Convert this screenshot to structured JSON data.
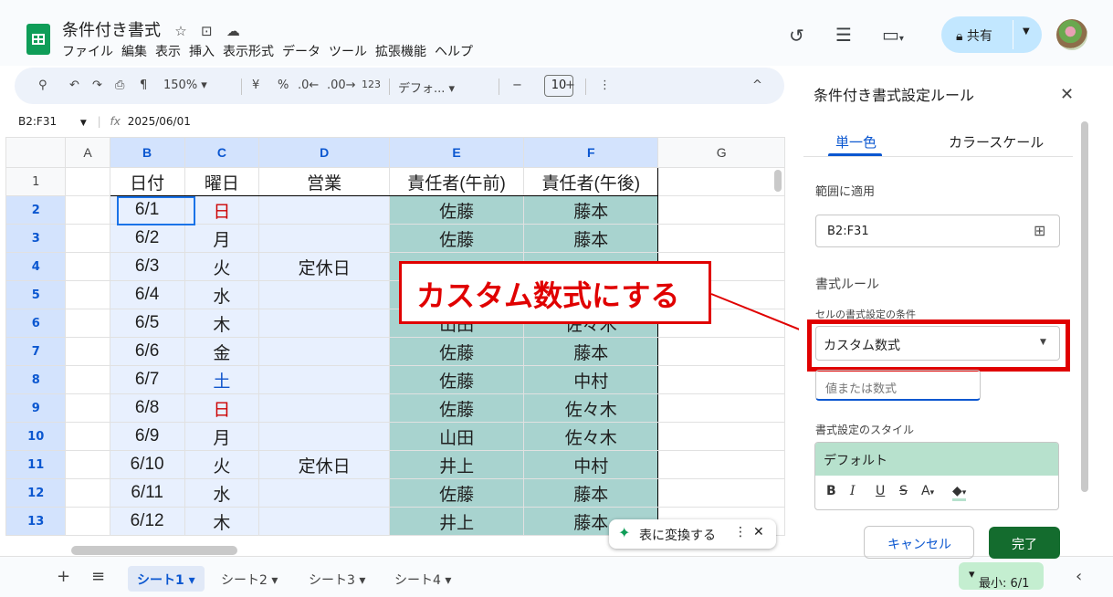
{
  "doc": {
    "title": "条件付き書式",
    "star_icon": "star-icon",
    "move_icon": "folder-move-icon",
    "cloud_icon": "cloud-icon",
    "menu": [
      "ファイル",
      "編集",
      "表示",
      "挿入",
      "表示形式",
      "データ",
      "ツール",
      "拡張機能",
      "ヘルプ"
    ]
  },
  "header": {
    "history_icon": "history-icon",
    "comment_icon": "comment-icon",
    "meet_icon": "video-icon",
    "share_label": "共有",
    "share_lock_icon": "lock-icon"
  },
  "toolbar": {
    "zoom": "150%",
    "currency": "¥",
    "percent": "%",
    "dec_minus": ".0←",
    "dec_plus": ".00→",
    "format123": "123",
    "font": "デフォ...",
    "font_size": "10",
    "minus": "−",
    "plus": "+",
    "more": "⋮",
    "collapse": "^"
  },
  "formula": {
    "name_box": "B2:F31",
    "fx": "fx",
    "value": "2025/06/01"
  },
  "columns": [
    "A",
    "B",
    "C",
    "D",
    "E",
    "F",
    "G"
  ],
  "rows": [
    {
      "n": "1",
      "b": "日付",
      "c": "曜日",
      "d": "営業",
      "e": "責任者(午前)",
      "f": "責任者(午後)",
      "ccolor": ""
    },
    {
      "n": "2",
      "b": "6/1",
      "c": "日",
      "d": "",
      "e": "佐藤",
      "f": "藤本",
      "ccolor": "red"
    },
    {
      "n": "3",
      "b": "6/2",
      "c": "月",
      "d": "",
      "e": "佐藤",
      "f": "藤本",
      "ccolor": ""
    },
    {
      "n": "4",
      "b": "6/3",
      "c": "火",
      "d": "定休日",
      "e": "",
      "f": "",
      "ccolor": ""
    },
    {
      "n": "5",
      "b": "6/4",
      "c": "水",
      "d": "",
      "e": "",
      "f": "",
      "ccolor": ""
    },
    {
      "n": "6",
      "b": "6/5",
      "c": "木",
      "d": "",
      "e": "山田",
      "f": "佐々木",
      "ccolor": ""
    },
    {
      "n": "7",
      "b": "6/6",
      "c": "金",
      "d": "",
      "e": "佐藤",
      "f": "藤本",
      "ccolor": ""
    },
    {
      "n": "8",
      "b": "6/7",
      "c": "土",
      "d": "",
      "e": "佐藤",
      "f": "中村",
      "ccolor": "blue"
    },
    {
      "n": "9",
      "b": "6/8",
      "c": "日",
      "d": "",
      "e": "佐藤",
      "f": "佐々木",
      "ccolor": "red"
    },
    {
      "n": "10",
      "b": "6/9",
      "c": "月",
      "d": "",
      "e": "山田",
      "f": "佐々木",
      "ccolor": ""
    },
    {
      "n": "11",
      "b": "6/10",
      "c": "火",
      "d": "定休日",
      "e": "井上",
      "f": "中村",
      "ccolor": ""
    },
    {
      "n": "12",
      "b": "6/11",
      "c": "水",
      "d": "",
      "e": "佐藤",
      "f": "藤本",
      "ccolor": ""
    },
    {
      "n": "13",
      "b": "6/12",
      "c": "木",
      "d": "",
      "e": "井上",
      "f": "藤本",
      "ccolor": ""
    }
  ],
  "callout": {
    "text": "カスタム数式にする"
  },
  "chip": {
    "label": "表に変換する",
    "star_icon": "sparkle-icon",
    "more": "⋮",
    "close": "✕"
  },
  "sheets": {
    "add": "+",
    "all": "≡",
    "tabs": [
      "シート1",
      "シート2",
      "シート3",
      "シート4"
    ],
    "summary": "最小: 6/1",
    "nav": "‹"
  },
  "panel": {
    "title": "条件付き書式設定ルール",
    "close": "✕",
    "tab_single": "単一色",
    "tab_scale": "カラースケール",
    "range_label": "範囲に適用",
    "range_value": "B2:F31",
    "rule_label": "書式ルール",
    "condition_label": "セルの書式設定の条件",
    "condition_value": "カスタム数式",
    "value_placeholder": "値または数式",
    "style_label": "書式設定のスタイル",
    "style_default": "デフォルト",
    "fmt": {
      "bold": "B",
      "italic": "I",
      "underline": "U",
      "strike": "S",
      "text_color": "A",
      "fill": "◆"
    },
    "cancel": "キャンセル",
    "done": "完了"
  }
}
